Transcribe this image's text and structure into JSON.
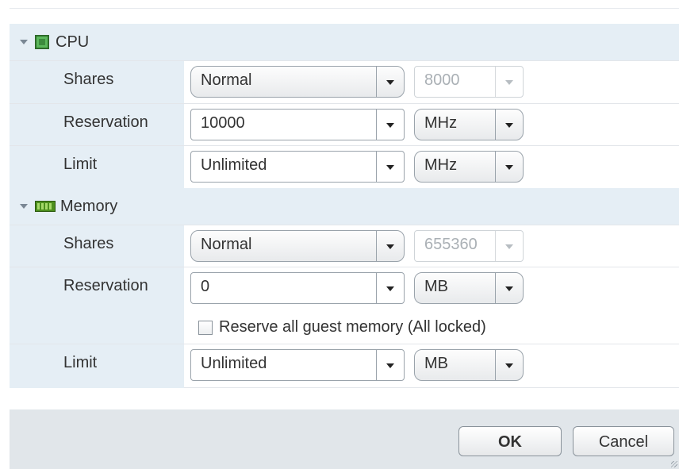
{
  "cpu": {
    "title": "CPU",
    "shares": {
      "label": "Shares",
      "value": "Normal",
      "number": "8000"
    },
    "reservation": {
      "label": "Reservation",
      "value": "10000",
      "unit": "MHz"
    },
    "limit": {
      "label": "Limit",
      "value": "Unlimited",
      "unit": "MHz"
    }
  },
  "memory": {
    "title": "Memory",
    "shares": {
      "label": "Shares",
      "value": "Normal",
      "number": "655360"
    },
    "reservation": {
      "label": "Reservation",
      "value": "0",
      "unit": "MB"
    },
    "reserve_all_label": "Reserve all guest memory (All locked)",
    "reserve_all_checked": false,
    "limit": {
      "label": "Limit",
      "value": "Unlimited",
      "unit": "MB"
    }
  },
  "footer": {
    "ok_label": "OK",
    "cancel_label": "Cancel"
  },
  "icons": {
    "cpu": "cpu-icon",
    "memory": "memory-icon"
  },
  "colors": {
    "section_bg": "#e5eef5",
    "footer_bg": "#e1e6ea",
    "cpu_icon": "#5cb85c",
    "memory_icon": "#4d8f1e"
  }
}
